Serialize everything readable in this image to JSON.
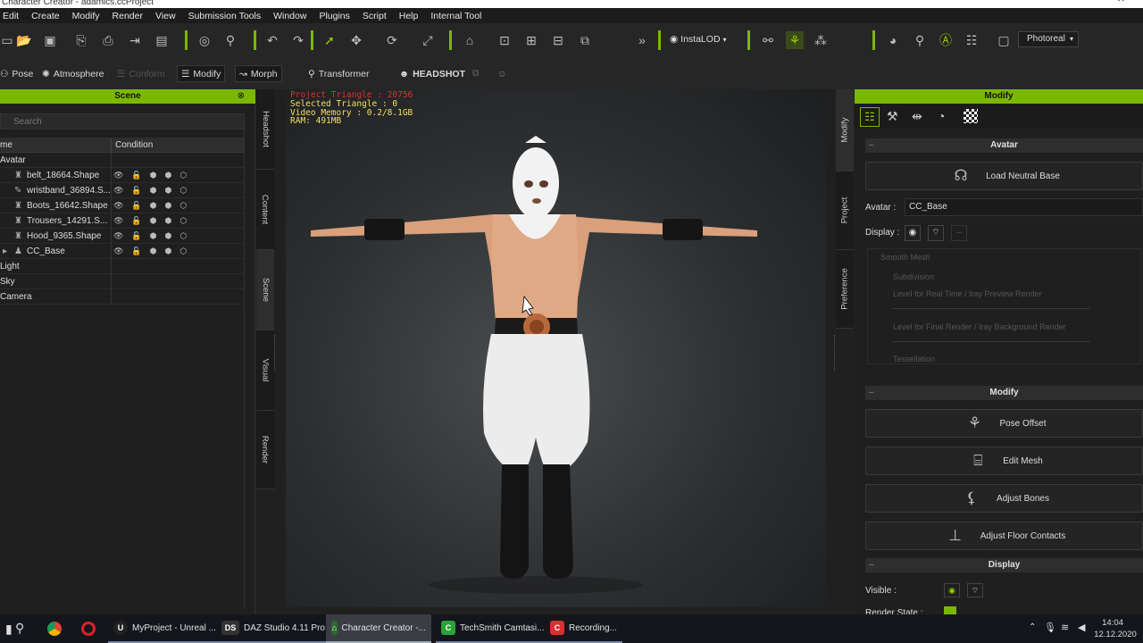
{
  "window": {
    "title": "Character Creator - adamics.ccProject"
  },
  "menu": [
    "Edit",
    "Create",
    "Modify",
    "Render",
    "View",
    "Submission Tools",
    "Window",
    "Plugins",
    "Script",
    "Help",
    "Internal Tool"
  ],
  "toolbar": {
    "instalod_label": "InstaLOD",
    "render_mode": "Photoreal"
  },
  "toolbar2": {
    "pose": "Pose",
    "atmosphere": "Atmosphere",
    "conform": "Conform",
    "modify": "Modify",
    "morph": "Morph",
    "transformer": "Transformer",
    "headshot": "HEADSHOT"
  },
  "scene": {
    "title": "Scene",
    "search_placeholder": "Search",
    "col_name": "me",
    "col_condition": "Condition",
    "rows": [
      {
        "label": "Avatar"
      },
      {
        "label": "belt_18664.Shape"
      },
      {
        "label": "wristband_36894.S..."
      },
      {
        "label": "Boots_16642.Shape"
      },
      {
        "label": "Trousers_14291.S..."
      },
      {
        "label": "Hood_9365.Shape"
      },
      {
        "label": "CC_Base"
      },
      {
        "label": "Light"
      },
      {
        "label": "Sky"
      },
      {
        "label": "Camera"
      }
    ]
  },
  "left_tabs": [
    "Headshot",
    "Content",
    "Scene",
    "Visual",
    "Render"
  ],
  "viewport": {
    "triangles": "Project Triangle : 20756",
    "selected": "Selected Triangle : 0",
    "vram": "Video Memory : 0.2/8.1GB",
    "ram": "RAM: 491MB"
  },
  "right_tabs": [
    "Modify",
    "Project",
    "Preference"
  ],
  "modify": {
    "title": "Modify",
    "avatar_section": "Avatar",
    "load_neutral": "Load Neutral Base",
    "avatar_label": "Avatar :",
    "avatar_value": "CC_Base",
    "display_label": "Display :",
    "smooth_mesh": "Smooth Mesh",
    "subdivision": "Subdivision",
    "level_realtime": "Level for Real Time / Iray Preview Render",
    "level_final": "Level for Final Render / Iray Background Render",
    "tessellation": "Tessellation",
    "modify_section": "Modify",
    "pose_offset": "Pose Offset",
    "edit_mesh": "Edit Mesh",
    "adjust_bones": "Adjust Bones",
    "adjust_floor": "Adjust Floor Contacts",
    "display_section": "Display",
    "visible_label": "Visible :",
    "render_state_label": "Render State :"
  },
  "taskbar": {
    "items": [
      "MyProject - Unreal ...",
      "DAZ Studio 4.11 Pro",
      "Character Creator -...",
      "TechSmith Camtasi...",
      "Recording..."
    ],
    "time": "14:04",
    "date": "12.12.2020"
  },
  "colors": {
    "accent": "#7ab800",
    "stats_red": "#e03030",
    "stats_yellow": "#f0e060"
  }
}
